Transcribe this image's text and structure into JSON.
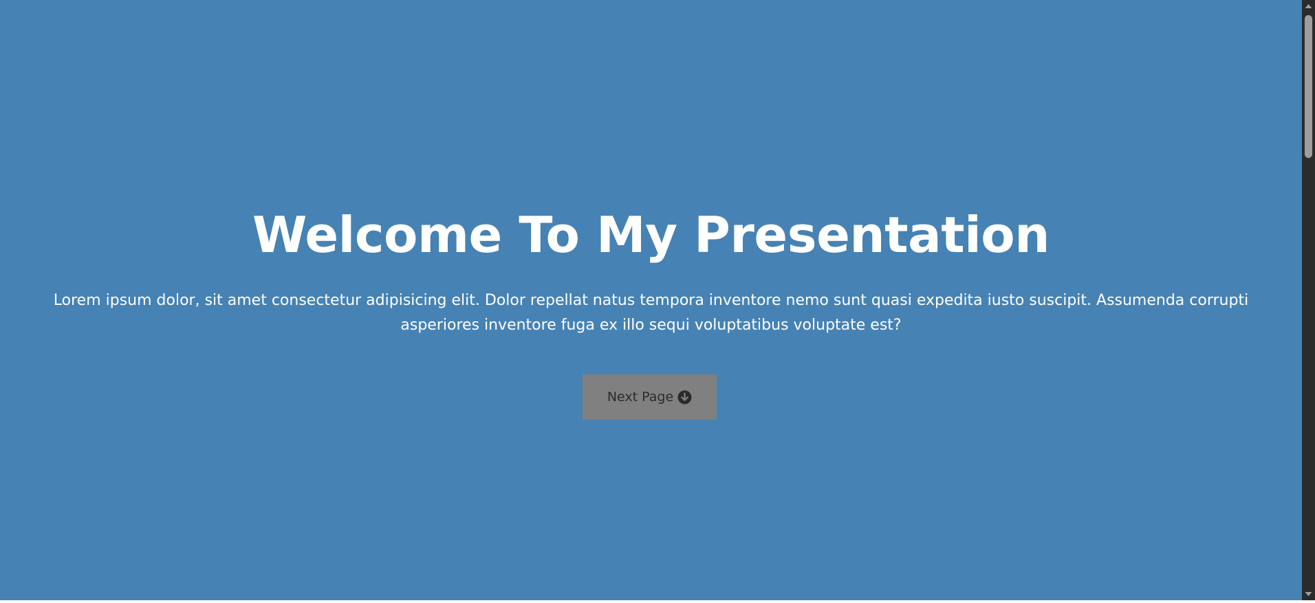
{
  "hero": {
    "title": "Welcome To My Presentation",
    "description": "Lorem ipsum dolor, sit amet consectetur adipisicing elit. Dolor repellat natus tempora inventore nemo sunt quasi expedita iusto suscipit. Assumenda corrupti asperiores inventore fuga ex illo sequi voluptatibus voluptate est?",
    "button_label": "Next Page",
    "button_icon": "arrow-circle-down-icon"
  },
  "colors": {
    "background": "#4682b4",
    "text": "#ffffff",
    "button_background": "#808080",
    "button_text": "#2b2b2b",
    "scrollbar_track": "#2b2b2b",
    "scrollbar_thumb": "#9e9e9e"
  }
}
